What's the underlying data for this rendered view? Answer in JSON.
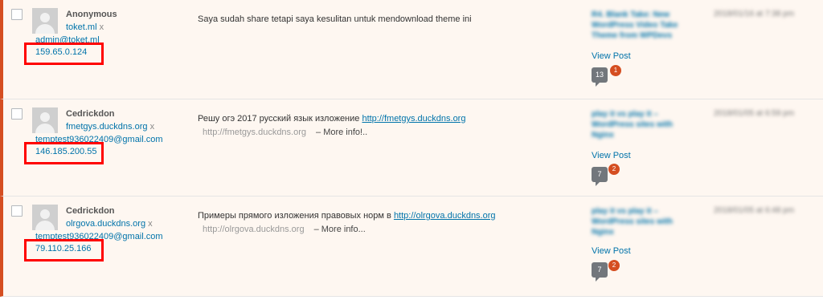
{
  "comments": [
    {
      "author_name": "Anonymous",
      "author_url": "toket.ml",
      "author_email": "admin@toket.ml",
      "author_ip": "159.65.0.124",
      "text": "Saya sudah share tetapi saya kesulitan untuk mendownload theme ini",
      "text_link": "",
      "sub_link": "",
      "more_label": "",
      "post_title": "R4. Blank Take: New WordPress Video Take Theme from WPDevs",
      "view_post": "View Post",
      "count": "13",
      "pending": "1",
      "date": "2018/01/16 at 7:38 pm"
    },
    {
      "author_name": "Cedrickdon",
      "author_url": "fmetgys.duckdns.org",
      "author_email": "temptest936022409@gmail.com",
      "author_ip": "146.185.200.55",
      "text": "Решу огэ 2017 русский язык изложение ",
      "text_link": "http://fmetgys.duckdns.org",
      "sub_link": "http://fmetgys.duckdns.org",
      "more_label": "– More info!..",
      "post_title": "play it vs play it – WordPress sites with Nginx",
      "view_post": "View Post",
      "count": "7",
      "pending": "2",
      "date": "2018/01/05 at 6:59 pm"
    },
    {
      "author_name": "Cedrickdon",
      "author_url": "olrgova.duckdns.org",
      "author_email": "temptest936022409@gmail.com",
      "author_ip": "79.110.25.166",
      "text": "Примеры прямого изложения правовых норм в ",
      "text_link": "http://olrgova.duckdns.org",
      "sub_link": "http://olrgova.duckdns.org",
      "more_label": "– More info...",
      "post_title": "play it vs play it – WordPress sites with Nginx",
      "view_post": "View Post",
      "count": "7",
      "pending": "2",
      "date": "2018/01/05 at 6:48 pm"
    }
  ],
  "author_separator": "x",
  "colors": {
    "accent": "#d54e21",
    "highlight": "#ff0000",
    "link": "#0073aa",
    "row_bg": "#fef7f1"
  }
}
